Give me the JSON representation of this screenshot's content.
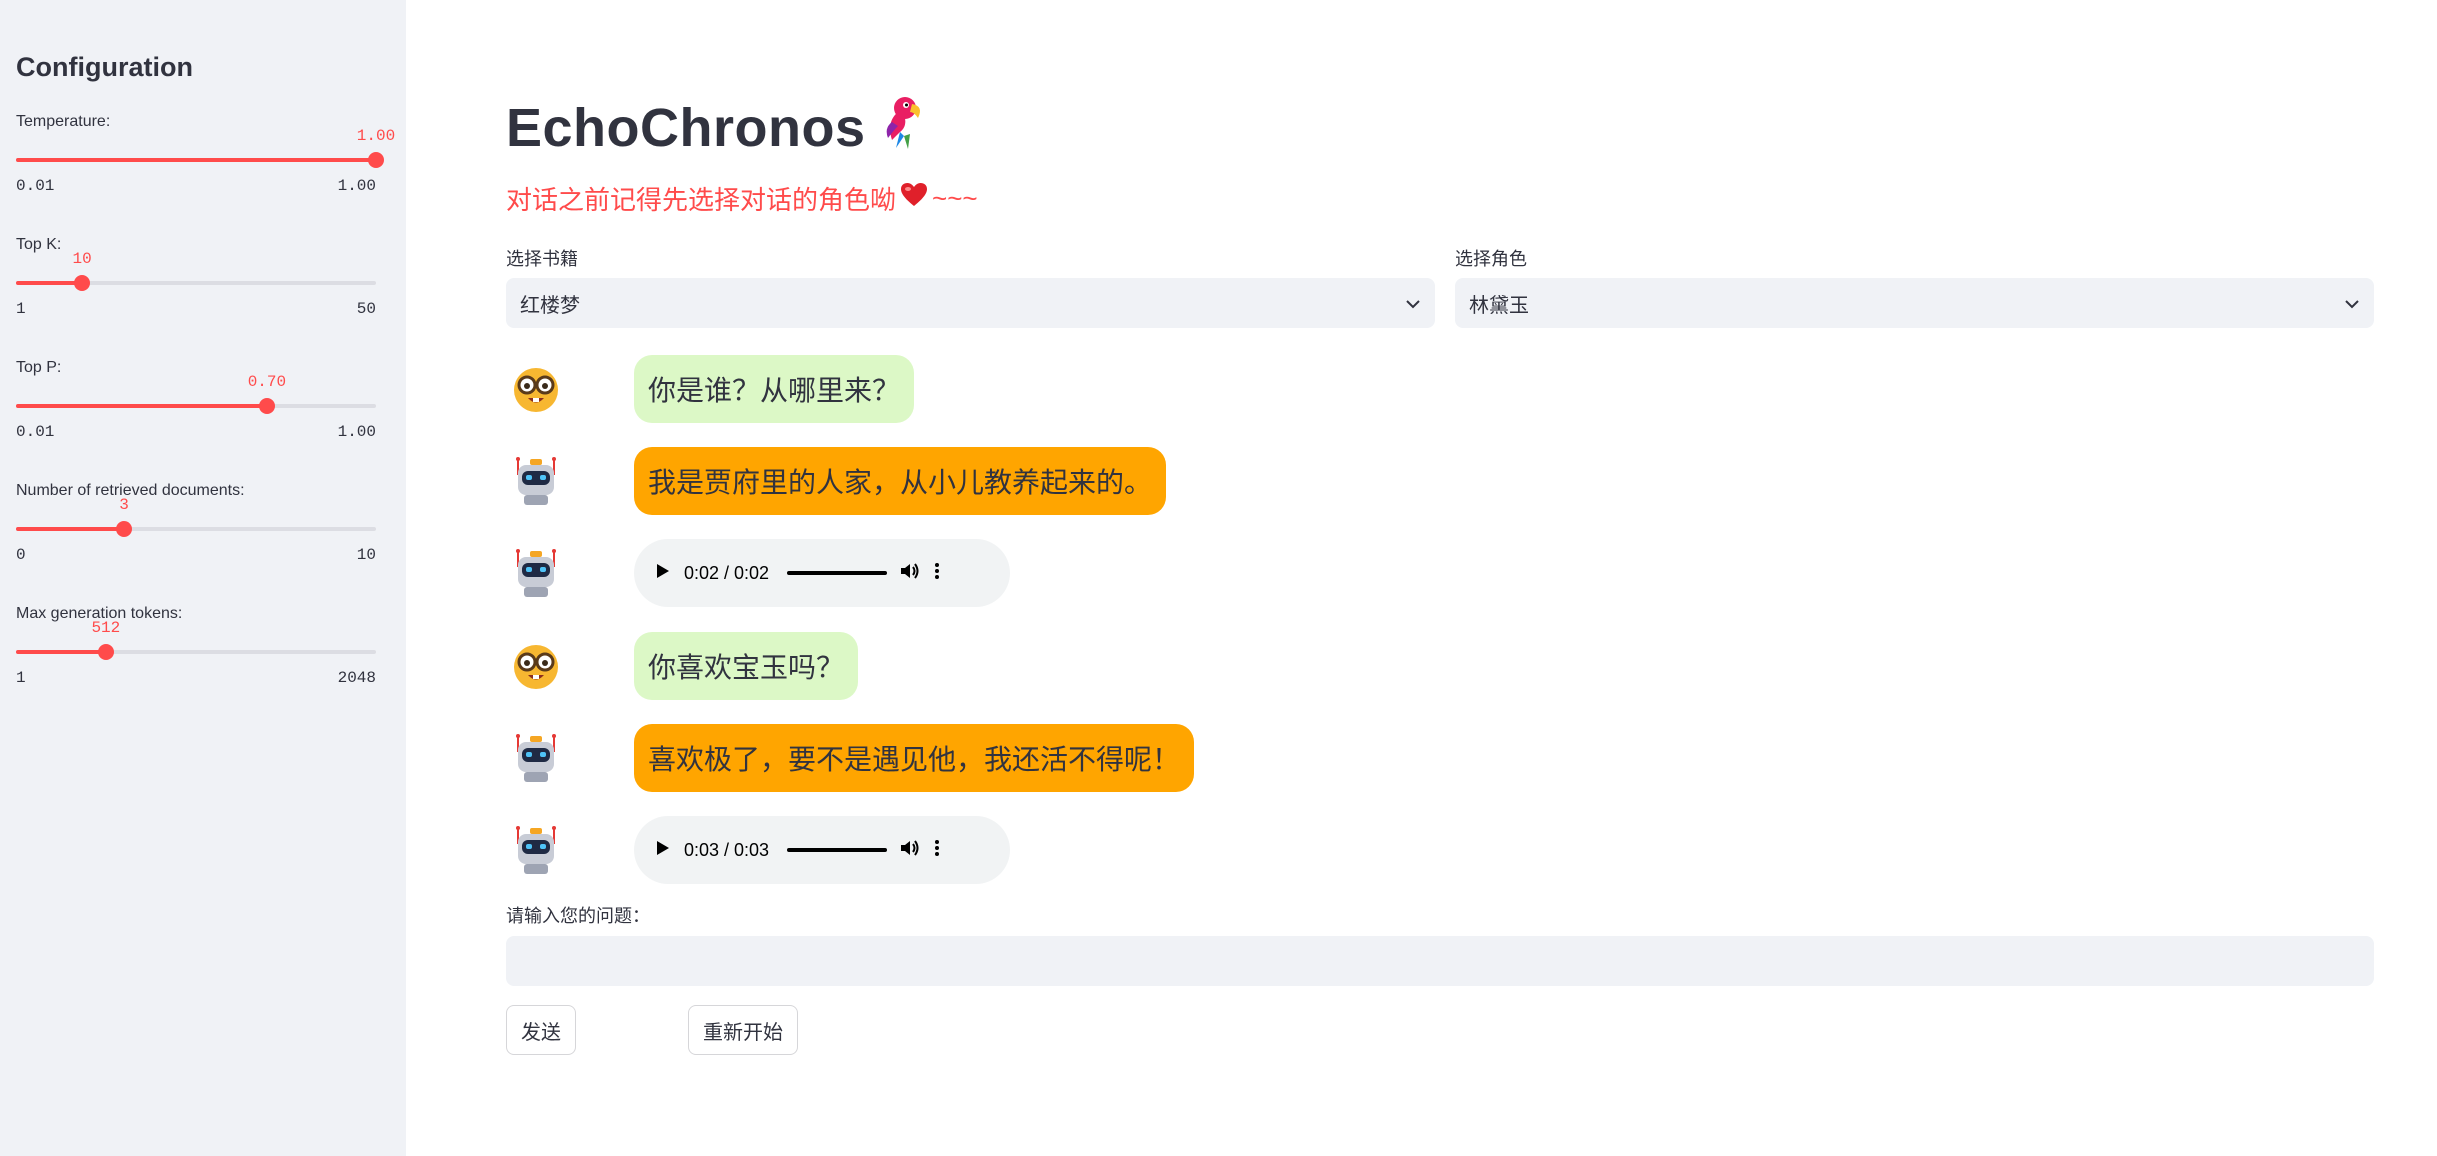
{
  "sidebar": {
    "title": "Configuration",
    "sliders": [
      {
        "label": "Temperature:",
        "value": "1.00",
        "min": "0.01",
        "max": "1.00",
        "fraction": 1.0
      },
      {
        "label": "Top K:",
        "value": "10",
        "min": "1",
        "max": "50",
        "fraction": 0.1837
      },
      {
        "label": "Top P:",
        "value": "0.70",
        "min": "0.01",
        "max": "1.00",
        "fraction": 0.697
      },
      {
        "label": "Number of retrieved documents:",
        "value": "3",
        "min": "0",
        "max": "10",
        "fraction": 0.3
      },
      {
        "label": "Max generation tokens:",
        "value": "512",
        "min": "1",
        "max": "2048",
        "fraction": 0.2496
      }
    ]
  },
  "main": {
    "title": "EchoChronos",
    "title_icon": "parrot-icon",
    "subtitle": "对话之前记得先选择对话的角色呦",
    "subtitle_tail": "~~~",
    "subtitle_icon": "heart-icon",
    "book_select": {
      "label": "选择书籍",
      "value": "红楼梦"
    },
    "role_select": {
      "label": "选择角色",
      "value": "林黛玉"
    },
    "messages": [
      {
        "role": "user",
        "avatar": "nerd-face-icon",
        "text": "你是谁？从哪里来？"
      },
      {
        "role": "bot",
        "avatar": "robot-icon",
        "text": "我是贾府里的人家，从小儿教养起来的。"
      },
      {
        "role": "bot-audio",
        "avatar": "robot-icon",
        "time": "0:02 / 0:02"
      },
      {
        "role": "user",
        "avatar": "nerd-face-icon",
        "text": "你喜欢宝玉吗？"
      },
      {
        "role": "bot",
        "avatar": "robot-icon",
        "text": "喜欢极了，要不是遇见他，我还活不得呢！"
      },
      {
        "role": "bot-audio",
        "avatar": "robot-icon",
        "time": "0:03 / 0:03"
      }
    ],
    "input_label": "请输入您的问题：",
    "input_value": "",
    "send_label": "发送",
    "restart_label": "重新开始"
  },
  "colors": {
    "accent": "#ff4b4b",
    "sidebar_bg": "#f0f2f6",
    "user_bubble": "#dcf8c6",
    "bot_bubble": "#ffa500"
  }
}
